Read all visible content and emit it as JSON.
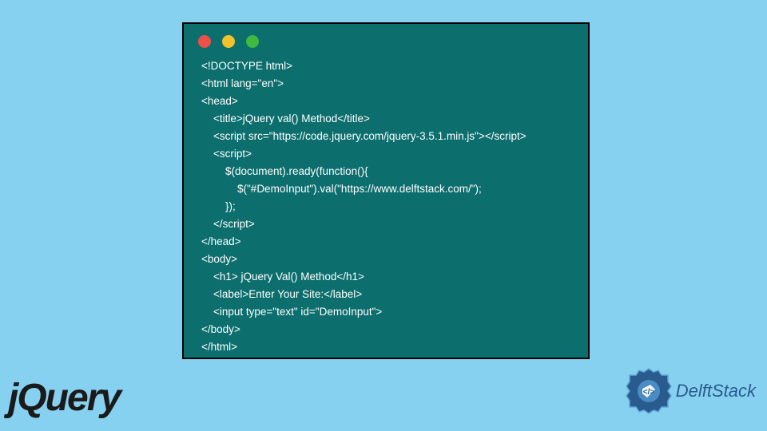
{
  "code": {
    "lines": [
      "<!DOCTYPE html>",
      "<html lang=\"en\">",
      "<head>",
      "    <title>jQuery val() Method</title>",
      "    <script src=\"https://code.jquery.com/jquery-3.5.1.min.js\"></script>",
      "    <script>",
      "        $(document).ready(function(){",
      "            $(\"#DemoInput\").val(\"https://www.delftstack.com/\");",
      "        });",
      "    </script>",
      "</head>",
      "<body>",
      "    <h1> jQuery Val() Method</h1>",
      "    <label>Enter Your Site:</label>",
      "    <input type=\"text\" id=\"DemoInput\">",
      "</body>",
      "</html>"
    ]
  },
  "logos": {
    "jquery": "jQuery",
    "delftstack": "DelftStack"
  }
}
